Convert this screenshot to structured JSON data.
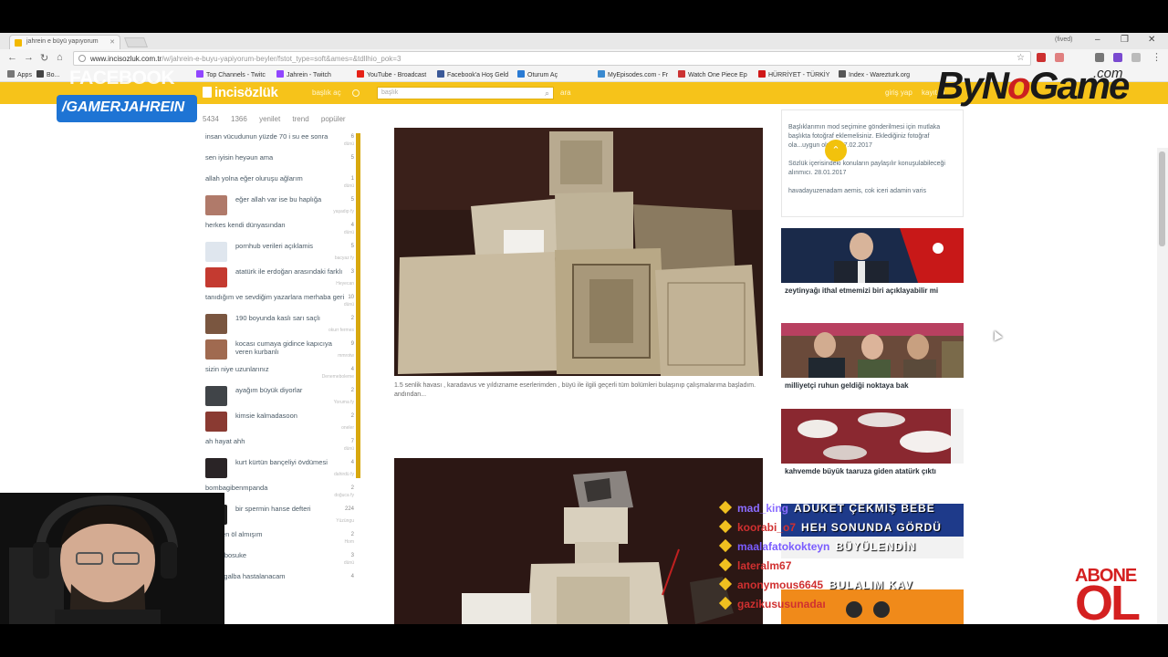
{
  "browser": {
    "tab_title": "jahrein e büyü yapıyorum",
    "window_user": "(fived)",
    "url_host": "www.incisozluk.com.tr",
    "url_path": "/w/jahrein-e-buyu-yapiyorum-beyler/fstot_type=soft&ames=&tdllhio_pok=3",
    "bookmarks": [
      {
        "label": "Apps",
        "color": "#777777"
      },
      {
        "label": "Bo...",
        "color": "#444444"
      },
      {
        "label": "Top Channels - Twitc",
        "color": "#9146ff"
      },
      {
        "label": "Jahrein - Twitch",
        "color": "#9146ff"
      },
      {
        "label": "YouTube - Broadcast",
        "color": "#e62117"
      },
      {
        "label": "Facebook'a Hoş Geld",
        "color": "#3b5998"
      },
      {
        "label": "Oturum Aç",
        "color": "#2a7bd4"
      },
      {
        "label": "MyEpisodes.com - Fr",
        "color": "#3a8ad0"
      },
      {
        "label": "Watch One Piece Ep",
        "color": "#cc3333"
      },
      {
        "label": "HÜRRİYET - TÜRKİY",
        "color": "#d01818"
      },
      {
        "label": "Index - Warezturk.org",
        "color": "#555555"
      }
    ]
  },
  "site": {
    "logo": "incisözlük",
    "header_links": [
      "başlık aç",
      "giriş yap",
      "kayıt ol"
    ],
    "search_placeholder": "başlık",
    "search_button": "ara",
    "subnav": [
      "5434",
      "1366",
      "yenilet",
      "trend",
      "popüler"
    ]
  },
  "left_list": [
    {
      "text": "insan vücudunun yüzde 70 i su ee sonra",
      "count": "6",
      "sub": "dünü"
    },
    {
      "text": "sen iyisin heyəun ama",
      "count": "5",
      "sub": ""
    },
    {
      "text": "allah yolna eğer oluruşu ağlarım",
      "count": "1",
      "sub": "dünü"
    },
    {
      "text": "eğer allah var ise bu haplığa",
      "count": "5",
      "sub": "yaşadıp fy",
      "thumb": "#b07a6a"
    },
    {
      "text": "herkes kendi dünyasından",
      "count": "4",
      "sub": "dünü"
    },
    {
      "text": "pornhub verileri açıklamis",
      "count": "5",
      "sub": "bacyaz fy",
      "thumb": "#dfe6ee"
    },
    {
      "text": "atatürk ile erdoğan arasındaki farklı",
      "count": "3",
      "sub": "Heyecan",
      "thumb": "#c43a30"
    },
    {
      "text": "tanıdığım ve sevdiğim yazarlara merhaba geri",
      "count": "10",
      "sub": "dünü"
    },
    {
      "text": "190 boyunda kaslı sarı saçlı",
      "count": "2",
      "sub": "okurr fermes",
      "thumb": "#7a5640"
    },
    {
      "text": "kocası cumaya gidince kapıcıya veren kurbanlı",
      "count": "9",
      "sub": "mmrotw",
      "thumb": "#a06a50"
    },
    {
      "text": "sizin niye uzunlarınız",
      "count": "4",
      "sub": "Denemeboleme"
    },
    {
      "text": "ayağım büyük diyorlar",
      "count": "2",
      "sub": "Yoruma fy",
      "thumb": "#404448"
    },
    {
      "text": "kimsie kalmadasoon",
      "count": "2",
      "sub": "oneler",
      "thumb": "#8a3a32"
    },
    {
      "text": "ah hayat ahh",
      "count": "7",
      "sub": "dünü"
    },
    {
      "text": "kurt kürtün bançeliyi övdümesi",
      "count": "4",
      "sub": "dahirdü fy",
      "thumb": "#2a2426"
    },
    {
      "text": "bombagibenmpanda",
      "count": "2",
      "sub": "doğuca fy"
    },
    {
      "text": "bir spermin hanse defteri",
      "count": "224",
      "sub": "Yüzüngu",
      "thumb": "#1e1e1e"
    },
    {
      "text": "flirk ben öl almışım",
      "count": "2",
      "sub": "Hom"
    },
    {
      "text": "slitluk bosuke",
      "count": "3",
      "sub": "dünü"
    },
    {
      "text": "moza galba hastalanacam",
      "count": "4",
      "sub": ""
    }
  ],
  "main": {
    "caption": "1.5 senlik havası , karadavus ve yıldızname eserlerimden , büyü ile ilgili geçerli tüm bolümleri bulaşınıp çalışmalarıma başladım. andından..."
  },
  "right": {
    "info_lines": [
      "Başlıklarımın mod seçimine gönderilmesi için mutlaka başlıkta fotoğraf eklemelisiniz. Eklediğiniz fotoğraf ola...uygun olmalı.07.02.2017",
      "Sözlük içerisindeki konuların paylaşılır konuşulabileceği alınmıcı. 28.01.2017",
      "havadayuzenadam aemis, cok iceri adamin varis"
    ],
    "cards": [
      {
        "title": "zeytinyağı ithal etmemizi biri açıklayabilir mi"
      },
      {
        "title": "milliyetçi ruhun geldiği noktaya bak"
      },
      {
        "title": "kahvemde büyük taaruza giden atatürk çıktı"
      }
    ]
  },
  "overlays": {
    "facebook_top": "FACEBOOK",
    "facebook_bottom": "/GAMERJAHREIN",
    "brand_left": "ByN",
    "brand_o": "o",
    "brand_right": "Game",
    "brand_com": ".com",
    "abone": "ABONE",
    "ol": "OL"
  },
  "chat": [
    {
      "user": "mad_king",
      "color": "#8a6cff",
      "msg": "ADUKET ÇEKMİŞ BEBE"
    },
    {
      "user": "koorabi_o7",
      "color": "#d03030",
      "msg": "HEH SONUNDA GÖRDÜ"
    },
    {
      "user": "maalafatokokteyn",
      "color": "#7a5cff",
      "msg": "BÜYÜLENDİN"
    },
    {
      "user": "lateralm67",
      "color": "#d03030",
      "msg": ""
    },
    {
      "user": "anonymous6645",
      "color": "#d03030",
      "msg": "BULALIM KAV"
    },
    {
      "user": "gazikususunadaı",
      "color": "#d03030",
      "msg": ""
    }
  ]
}
